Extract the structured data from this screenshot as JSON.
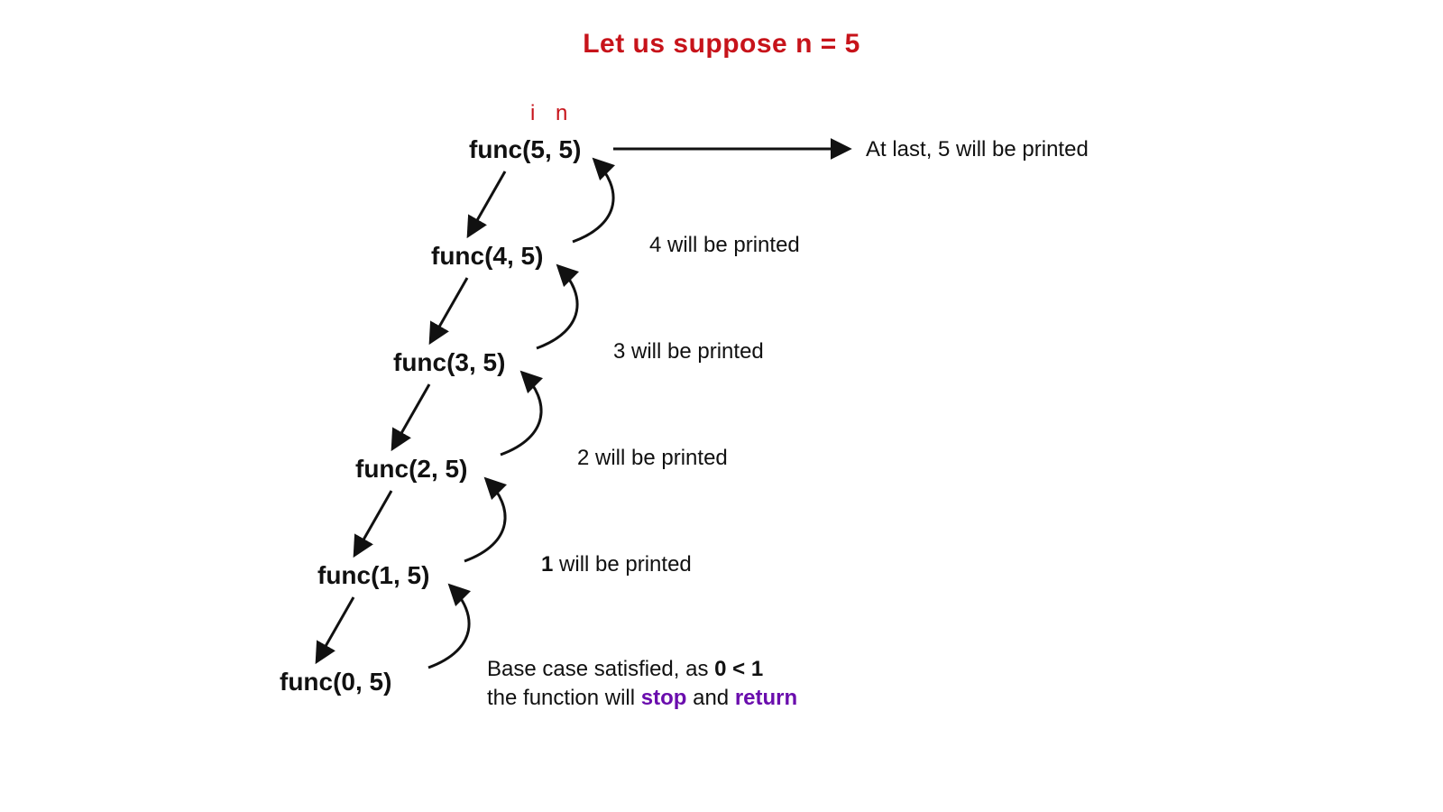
{
  "title": "Let us suppose n = 5",
  "param_i": "i",
  "param_n": "n",
  "calls": {
    "c5": "func(5, 5)",
    "c4": "func(4, 5)",
    "c3": "func(3, 5)",
    "c2": "func(2, 5)",
    "c1": "func(1, 5)",
    "c0": "func(0, 5)"
  },
  "notes": {
    "last5": "At last, 5 will be printed",
    "p4": "4 will be printed",
    "p3": "3 will be printed",
    "p2": "2 will be printed",
    "p1_bold": "1",
    "p1_rest": " will be printed",
    "base_line1_a": "Base case satisfied, as ",
    "base_line1_b": "0 < 1",
    "base_line2_a": "the function will ",
    "base_line2_stop": "stop",
    "base_line2_and": " and ",
    "base_line2_return": "return"
  }
}
